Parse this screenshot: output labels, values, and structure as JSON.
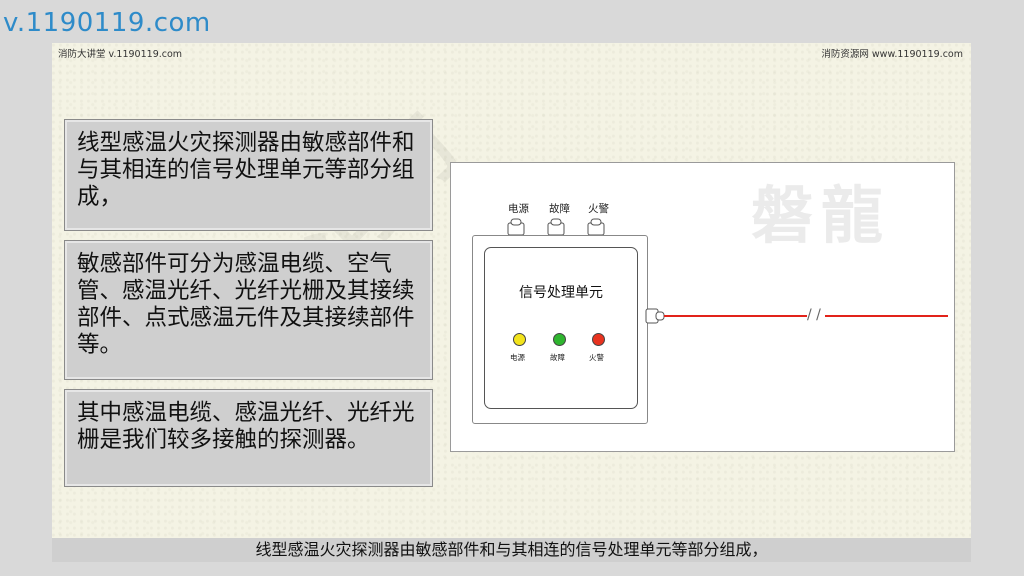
{
  "corner_watermark": "v.1190119.com",
  "slide": {
    "header_left": "消防大讲堂 v.1190119.com",
    "header_right": "消防资源网 www.1190119.com",
    "paragraphs": [
      "线型感温火灾探测器由敏感部件和与其相连的信号处理单元等部分组成，",
      "敏感部件可分为感温电缆、空气管、感温光纤、光纤光栅及其接续部件、点式感温元件及其接续部件等。",
      "其中感温电缆、感温光纤、光纤光栅是我们较多接触的探测器。"
    ],
    "background_watermark": "消防"
  },
  "diagram": {
    "watermark": "磐龍",
    "top_labels": [
      "电源",
      "故障",
      "火警"
    ],
    "unit_title": "信号处理单元",
    "indicators": [
      {
        "label": "电源",
        "color": "#f2e31c"
      },
      {
        "label": "故障",
        "color": "#2fb52f"
      },
      {
        "label": "火警",
        "color": "#e8331f"
      }
    ],
    "cable_color": "#e2231a"
  },
  "subtitle": "线型感温火灾探测器由敏感部件和与其相连的信号处理单元等部分组成，"
}
